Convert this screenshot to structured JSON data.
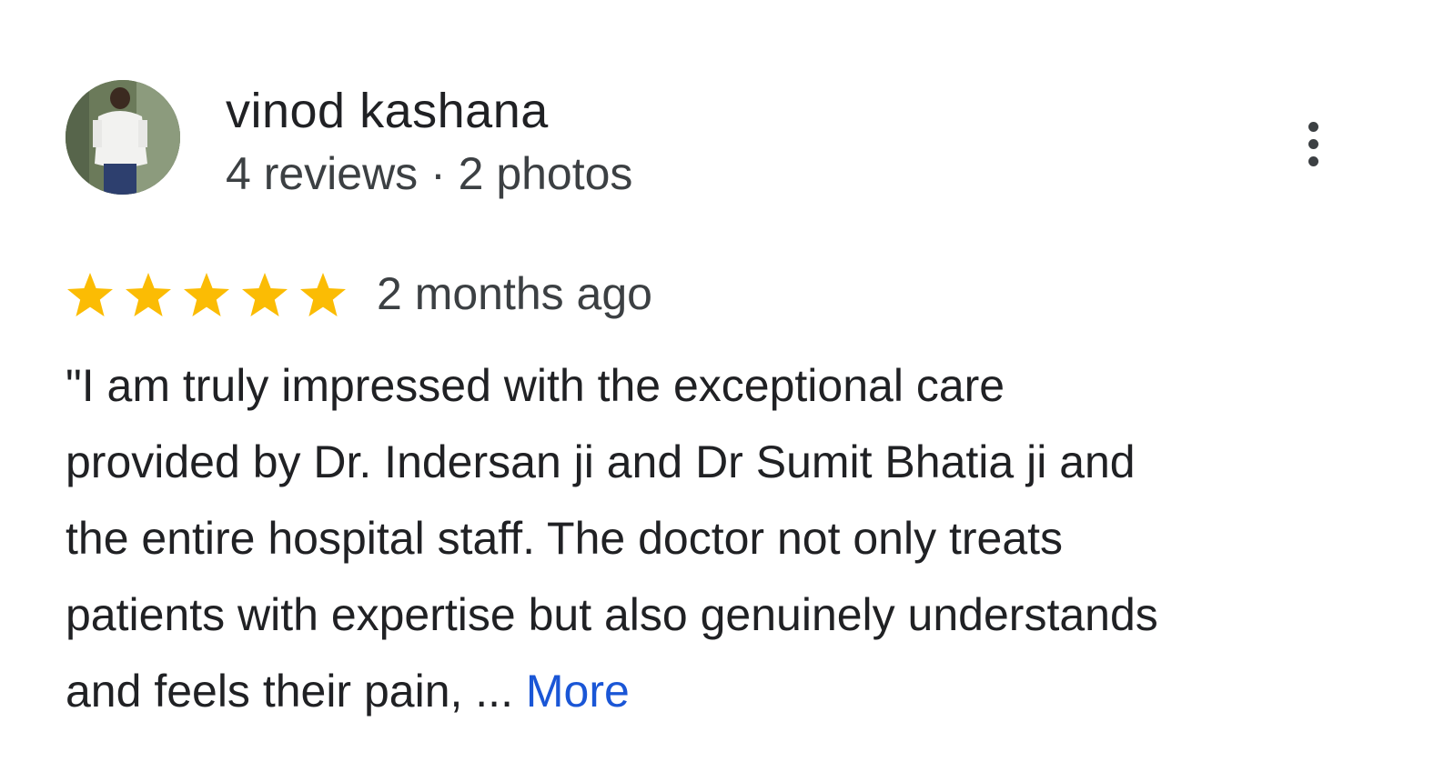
{
  "reviewer": {
    "name": "vinod kashana",
    "meta": "4 reviews · 2 photos"
  },
  "rating": {
    "stars": 5,
    "max": 5,
    "star_color": "#fbbc04",
    "date": "2 months ago"
  },
  "review": {
    "lines": [
      "\"I am truly impressed with the exceptional care",
      "provided by Dr. Indersan ji and Dr Sumit Bhatia ji and",
      "the entire hospital staff. The doctor not only treats",
      "patients with expertise but also genuinely understands",
      "and feels their pain, ... "
    ],
    "more_label": "More",
    "link_color": "#1a56d6"
  },
  "icons": {
    "menu": "more-vert-icon",
    "star": "star-icon",
    "avatar": "avatar-photo"
  }
}
